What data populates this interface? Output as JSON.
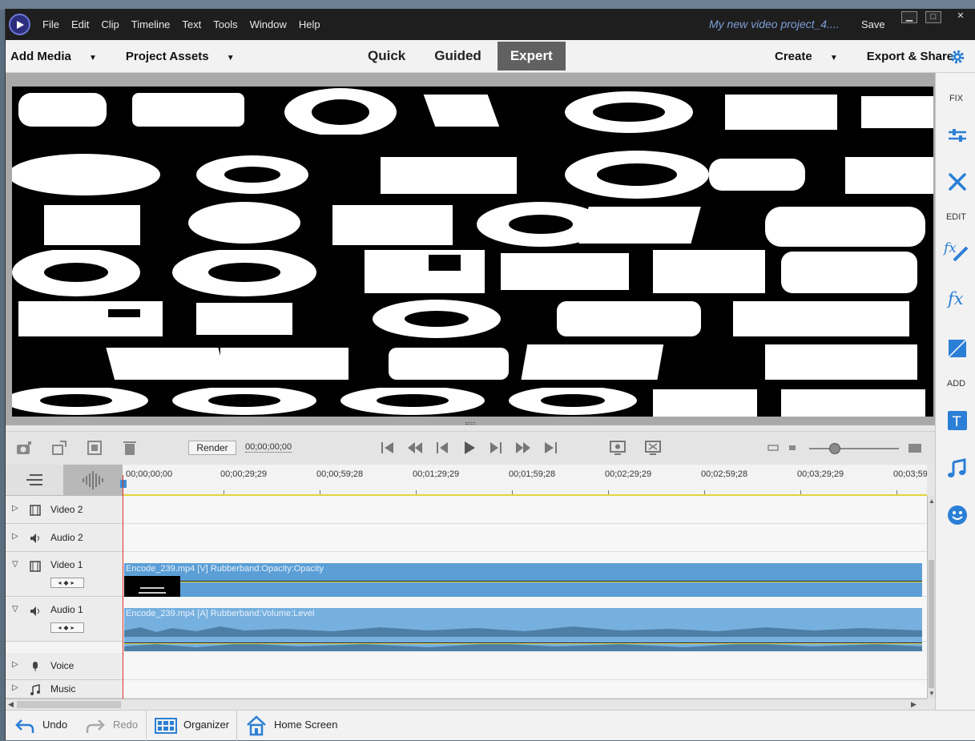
{
  "app": {
    "project_name": "My new video project_4....",
    "save_label": "Save",
    "minimize": "▁",
    "maximize": "□",
    "close": "✕",
    "menu": [
      "File",
      "Edit",
      "Clip",
      "Timeline",
      "Text",
      "Tools",
      "Window",
      "Help"
    ]
  },
  "toolbar": {
    "add_media": "Add Media",
    "project_assets": "Project Assets",
    "modes": [
      "Quick",
      "Guided",
      "Expert"
    ],
    "active_mode": "Expert",
    "create": "Create",
    "export_share": "Export & Share"
  },
  "right_panel": {
    "fix_label": "FIX",
    "edit_label": "EDIT",
    "add_label": "ADD"
  },
  "transport": {
    "render_label": "Render",
    "timecode": "00;00;00;00"
  },
  "timeline": {
    "ruler": [
      "00;00;00;00",
      "00;00;29;29",
      "00;00;59;28",
      "00;01;29;29",
      "00;01;59;28",
      "00;02;29;29",
      "00;02;59;28",
      "00;03;29;29",
      "00;03;59"
    ],
    "tracks": [
      {
        "name": "Video 2"
      },
      {
        "name": "Audio 2"
      },
      {
        "name": "Video 1"
      },
      {
        "name": "Audio 1"
      },
      {
        "name": "Voice"
      },
      {
        "name": "Music"
      }
    ],
    "video_clip_label": "Encode_239.mp4 [V] Rubberband:Opacity:Opacity",
    "audio_clip_label": "Encode_239.mp4 [A] Rubberband:Volume:Level"
  },
  "bottom": {
    "undo": "Undo",
    "redo": "Redo",
    "organizer": "Organizer",
    "home_screen": "Home Screen"
  },
  "colors": {
    "clip_video": "#5b9fd6",
    "clip_audio": "#76b0df",
    "rubberband": "#f0e24a",
    "playhead": "#e0302b",
    "accent_blue": "#2b7fd6"
  }
}
